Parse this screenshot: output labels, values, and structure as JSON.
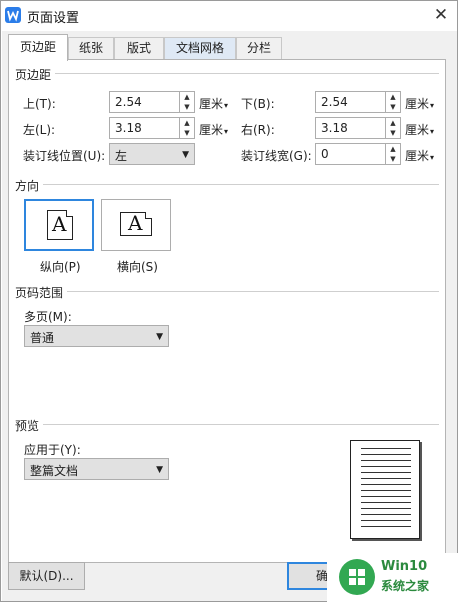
{
  "window": {
    "title": "页面设置",
    "app_icon": "wps-writer-icon"
  },
  "tabs": [
    {
      "label": "页边距",
      "active": true
    },
    {
      "label": "纸张",
      "active": false
    },
    {
      "label": "版式",
      "active": false
    },
    {
      "label": "文档网格",
      "active": false
    },
    {
      "label": "分栏",
      "active": false
    }
  ],
  "margins": {
    "group_title": "页边距",
    "top": {
      "label": "上(T):",
      "value": "2.54",
      "unit": "厘米"
    },
    "bottom": {
      "label": "下(B):",
      "value": "2.54",
      "unit": "厘米"
    },
    "left": {
      "label": "左(L):",
      "value": "3.18",
      "unit": "厘米"
    },
    "right": {
      "label": "右(R):",
      "value": "3.18",
      "unit": "厘米"
    },
    "gutter_pos": {
      "label": "装订线位置(U):",
      "value": "左"
    },
    "gutter": {
      "label": "装订线宽(G):",
      "value": "0",
      "unit": "厘米"
    }
  },
  "orientation": {
    "group_title": "方向",
    "portrait": {
      "glyph": "A",
      "label": "纵向(P)",
      "selected": true
    },
    "landscape": {
      "glyph": "A",
      "label": "横向(S)",
      "selected": false
    }
  },
  "pages": {
    "group_title": "页码范围",
    "multi_label": "多页(M):",
    "multi_value": "普通"
  },
  "preview": {
    "group_title": "预览",
    "apply_label": "应用于(Y):",
    "apply_value": "整篇文档"
  },
  "buttons": {
    "default_label": "默认(D)...",
    "ok_label": "确"
  },
  "watermark": {
    "line1": "Win10",
    "line2": "系统之家"
  },
  "colors": {
    "accent": "#2e86de",
    "title_icon": "#2b7de9",
    "watermark": "#32a852"
  }
}
